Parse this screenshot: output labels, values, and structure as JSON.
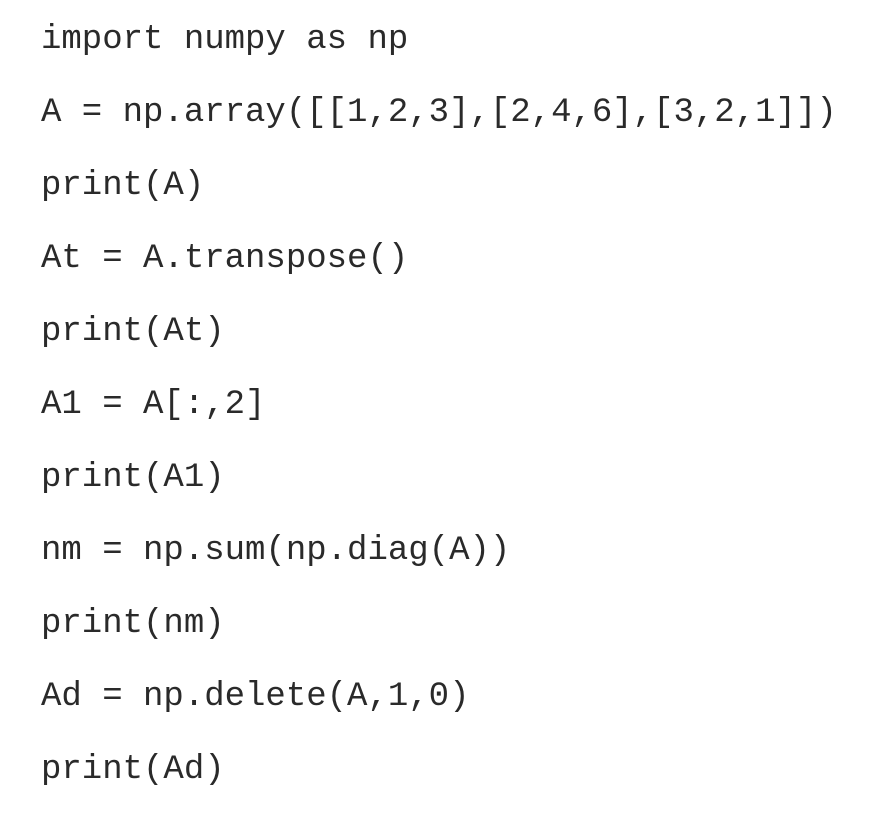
{
  "document": {
    "language": "python",
    "lines": [
      "import numpy as np",
      "A = np.array([[1,2,3],[2,4,6],[3,2,1]])",
      "print(A)",
      "At = A.transpose()",
      "print(At)",
      "A1 = A[:,2]",
      "print(A1)",
      "nm = np.sum(np.diag(A))",
      "print(nm)",
      "Ad = np.delete(A,1,0)",
      "print(Ad)"
    ]
  }
}
